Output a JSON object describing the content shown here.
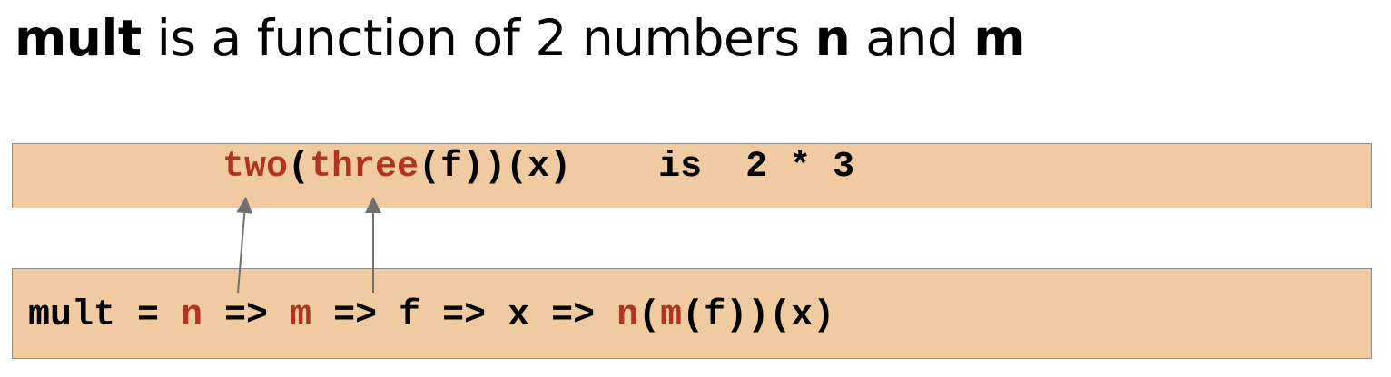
{
  "title": {
    "w1": "mult",
    "w2": " is a function of 2 numbers ",
    "w3": "n",
    "w4": " and ",
    "w5": "m"
  },
  "top_code": [
    {
      "text": "two",
      "color": "red"
    },
    {
      "text": "(",
      "color": "black"
    },
    {
      "text": "three",
      "color": "red"
    },
    {
      "text": "(f))(x)    is  2 * 3",
      "color": "black"
    }
  ],
  "bottom_code": [
    {
      "text": "mult = ",
      "color": "black"
    },
    {
      "text": "n",
      "color": "red"
    },
    {
      "text": " => ",
      "color": "black"
    },
    {
      "text": "m",
      "color": "red"
    },
    {
      "text": " => f => x => ",
      "color": "black"
    },
    {
      "text": "n",
      "color": "red"
    },
    {
      "text": "(",
      "color": "black"
    },
    {
      "text": "m",
      "color": "red"
    },
    {
      "text": "(f))(x)",
      "color": "black"
    }
  ],
  "colors": {
    "red": "#b03520",
    "black": "#000000",
    "box": "#f0cba1",
    "arrow": "#707070"
  }
}
